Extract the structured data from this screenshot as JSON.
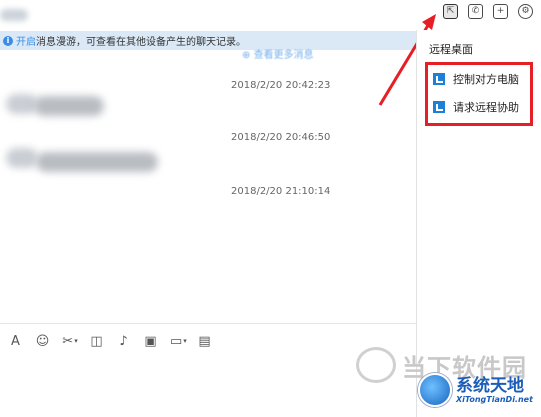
{
  "notice": {
    "link": "开启",
    "text": "消息漫游，可查看在其他设备产生的聊天记录。"
  },
  "messages": {
    "more_label": "查看更多消息",
    "timestamps": [
      "2018/2/20 20:42:23",
      "2018/2/20 20:46:50",
      "2018/2/20 21:10:14"
    ]
  },
  "top_icons": [
    {
      "name": "remote-desktop-icon",
      "glyph": "⇱"
    },
    {
      "name": "phone-icon",
      "glyph": "✆"
    },
    {
      "name": "add-icon",
      "glyph": "+"
    },
    {
      "name": "settings-icon",
      "glyph": "⚙"
    }
  ],
  "remote_panel": {
    "title": "远程桌面",
    "items": [
      "控制对方电脑",
      "请求远程协助"
    ]
  },
  "input_tools": [
    {
      "name": "font-icon",
      "glyph": "A"
    },
    {
      "name": "emoji-icon",
      "glyph": "☺"
    },
    {
      "name": "scissors-icon",
      "glyph": "✂"
    },
    {
      "name": "shake-icon",
      "glyph": "◫"
    },
    {
      "name": "voice-icon",
      "glyph": "♪"
    },
    {
      "name": "image-icon",
      "glyph": "▣"
    },
    {
      "name": "folder-icon",
      "glyph": "▭"
    },
    {
      "name": "clipboard-icon",
      "glyph": "▤"
    }
  ],
  "watermark": {
    "site1": "当下软件园",
    "site2_title": "系统天地",
    "site2_url": "XiTongTianDi.net"
  },
  "colors": {
    "accent": "#3a8ee6",
    "highlight": "#e61e25",
    "notice_bg": "#dbe9f7"
  }
}
